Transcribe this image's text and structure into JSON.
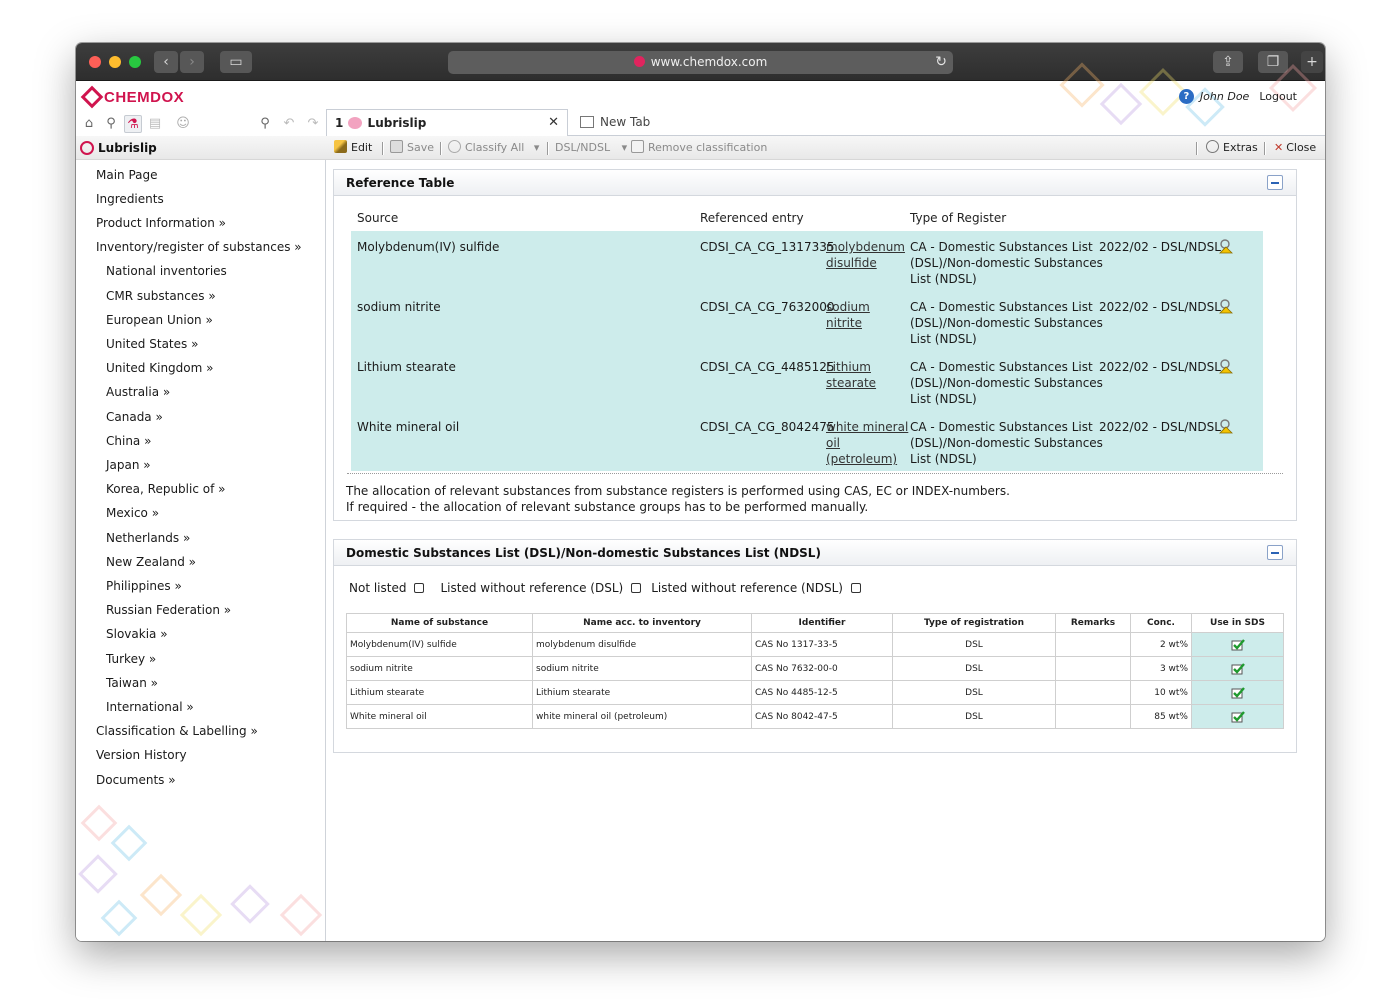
{
  "browser": {
    "url": "www.chemdox.com"
  },
  "app": {
    "logo_text": "CHEMDOX",
    "user_name": "John Doe",
    "logout_label": "Logout"
  },
  "tabs": [
    {
      "number": "1",
      "label": "Lubrislip"
    },
    {
      "label": "New Tab"
    }
  ],
  "sidebar": {
    "title": "Lubrislip",
    "items": [
      "Main Page",
      "Ingredients",
      "Product Information »",
      "Inventory/register of substances »",
      "National inventories",
      "CMR substances »",
      "European Union »",
      "United States »",
      "United Kingdom »",
      "Australia »",
      "Canada »",
      "China »",
      "Japan »",
      "Korea, Republic of »",
      "Mexico »",
      "Netherlands »",
      "New Zealand »",
      "Philippines »",
      "Russian Federation »",
      "Slovakia »",
      "Turkey »",
      "Taiwan »",
      "International »",
      "Classification & Labelling »",
      "Version History",
      "Documents »"
    ]
  },
  "toolbar": {
    "edit": "Edit",
    "save": "Save",
    "classify_all": "Classify All",
    "dsl_ndsl": "DSL/NDSL",
    "remove_classification": "Remove classification",
    "extras": "Extras",
    "close": "Close"
  },
  "reference_table": {
    "title": "Reference Table",
    "headers": {
      "source": "Source",
      "entry": "Referenced entry",
      "type": "Type of Register"
    },
    "rows": [
      {
        "source": "Molybdenum(IV) sulfide",
        "id": "CDSI_CA_CG_1317335",
        "link": [
          "molybdenum",
          "disulfide"
        ],
        "register": [
          "CA - Domestic Substances List",
          "(DSL)/Non-domestic Substances",
          "List (NDSL)"
        ],
        "version": "2022/02 - DSL/NDSL"
      },
      {
        "source": "sodium nitrite",
        "id": "CDSI_CA_CG_7632000",
        "link": [
          "sodium",
          "nitrite"
        ],
        "register": [
          "CA - Domestic Substances List",
          "(DSL)/Non-domestic Substances",
          "List (NDSL)"
        ],
        "version": "2022/02 - DSL/NDSL"
      },
      {
        "source": "Lithium stearate",
        "id": "CDSI_CA_CG_4485125",
        "link": [
          "Lithium",
          "stearate"
        ],
        "register": [
          "CA - Domestic Substances List",
          "(DSL)/Non-domestic Substances",
          "List (NDSL)"
        ],
        "version": "2022/02 - DSL/NDSL"
      },
      {
        "source": "White mineral oil",
        "id": "CDSI_CA_CG_8042475",
        "link": [
          "white mineral",
          "oil",
          "(petroleum)"
        ],
        "register": [
          "CA - Domestic Substances List",
          "(DSL)/Non-domestic Substances",
          "List (NDSL)"
        ],
        "version": "2022/02 - DSL/NDSL"
      }
    ],
    "note_1": "The allocation of relevant substances from substance registers is performed using CAS, EC or INDEX-numbers.",
    "note_2": "If required - the allocation of relevant substance groups has to be performed manually."
  },
  "dsl_panel": {
    "title": "Domestic Substances List (DSL)/Non-domestic Substances List (NDSL)",
    "checkboxes": [
      "Not listed",
      "Listed without reference (DSL)",
      "Listed without reference (NDSL)"
    ],
    "columns": [
      "Name of substance",
      "Name acc. to inventory",
      "Identifier",
      "Type of registration",
      "Remarks",
      "Conc.",
      "Use in SDS"
    ],
    "rows": [
      {
        "name": "Molybdenum(IV) sulfide",
        "inventory_name": "molybdenum disulfide",
        "identifier": "CAS No 1317-33-5",
        "type": "DSL",
        "remarks": "",
        "conc": "2 wt%",
        "use_in_sds": true
      },
      {
        "name": "sodium nitrite",
        "inventory_name": "sodium nitrite",
        "identifier": "CAS No 7632-00-0",
        "type": "DSL",
        "remarks": "",
        "conc": "3 wt%",
        "use_in_sds": true
      },
      {
        "name": "Lithium stearate",
        "inventory_name": "Lithium stearate",
        "identifier": "CAS No 4485-12-5",
        "type": "DSL",
        "remarks": "",
        "conc": "10 wt%",
        "use_in_sds": true
      },
      {
        "name": "White mineral oil",
        "inventory_name": "white mineral oil (petroleum)",
        "identifier": "CAS No 8042-47-5",
        "type": "DSL",
        "remarks": "",
        "conc": "85 wt%",
        "use_in_sds": true
      }
    ]
  }
}
